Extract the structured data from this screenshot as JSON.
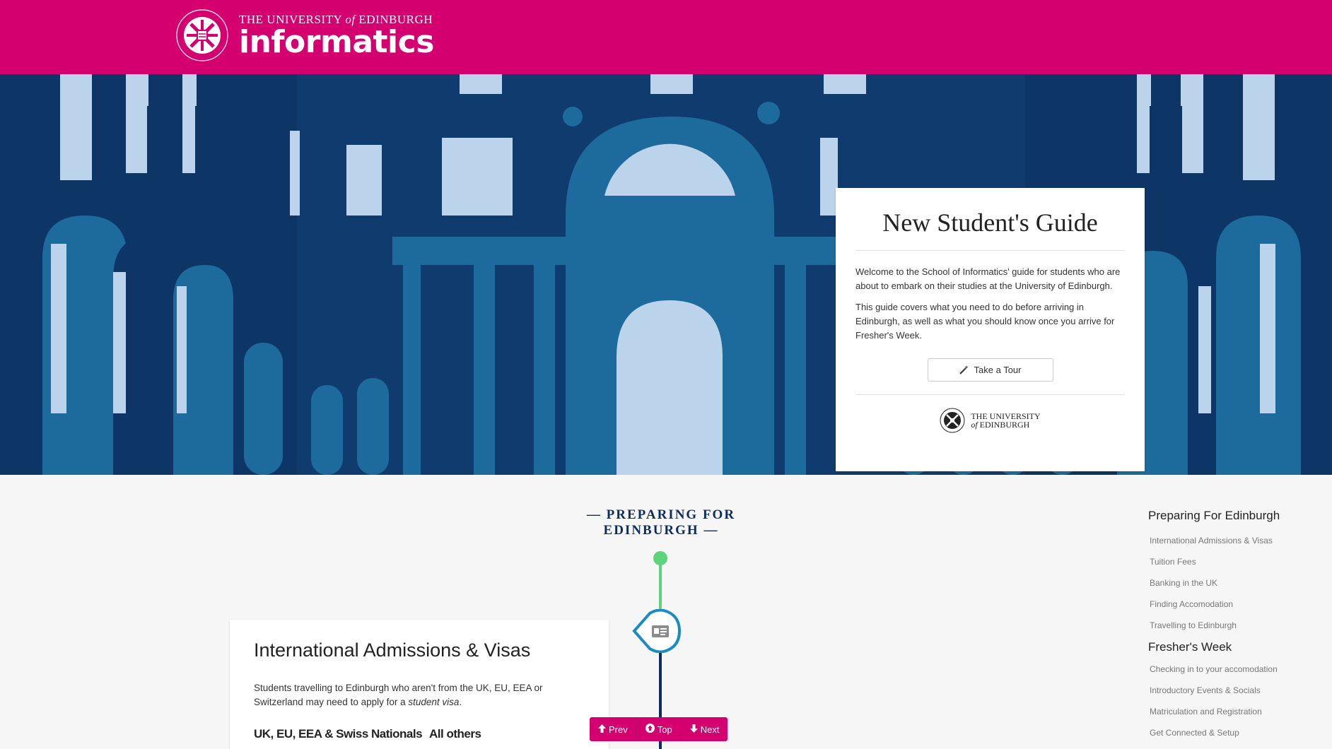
{
  "header": {
    "university_line_pre": "THE UNIVERSITY ",
    "university_line_of": "of",
    "university_line_post": " EDINBURGH",
    "brand": "informatics",
    "crest_icon": "university-crest-icon",
    "colors": {
      "brand": "#d50070",
      "navy": "#0f2d5c"
    }
  },
  "guide": {
    "title": "New Student's Guide",
    "intro": "Welcome to the School of Informatics' guide for students who are about to embark on their studies at the University of Edinburgh.",
    "covers": "This guide covers what you need to do before arriving in Edinburgh, as well as what you should know once you arrive for Fresher's Week.",
    "tour_button": "Take a Tour",
    "tour_icon": "magic-wand-icon",
    "footer_logo_line1": "THE UNIVERSITY",
    "footer_logo_of": "of",
    "footer_logo_line2": " EDINBURGH"
  },
  "section": {
    "title": "—  PREPARING FOR EDINBURGH  —"
  },
  "timeline": {
    "marker_icon": "id-card-icon"
  },
  "card": {
    "title": "International Admissions & Visas",
    "body_pre": "Students travelling to Edinburgh who aren't from the UK, EU, EEA or Switzerland may need to apply for a ",
    "body_em": "student visa",
    "body_post": ".",
    "col1": "UK, EU, EEA & Swiss Nationals",
    "col2": "All others"
  },
  "float_nav": {
    "prev": "Prev",
    "top": "Top",
    "next": "Next"
  },
  "sidebar": {
    "group1": "Preparing For Edinburgh",
    "items1": [
      "International Admissions & Visas",
      "Tuition Fees",
      "Banking in the UK",
      "Finding Accomodation",
      "Travelling to Edinburgh"
    ],
    "group2": "Fresher's Week",
    "items2": [
      "Checking in to your accomodation",
      "Introductory Events & Socials",
      "Matriculation and Registration",
      "Get Connected & Setup"
    ]
  }
}
